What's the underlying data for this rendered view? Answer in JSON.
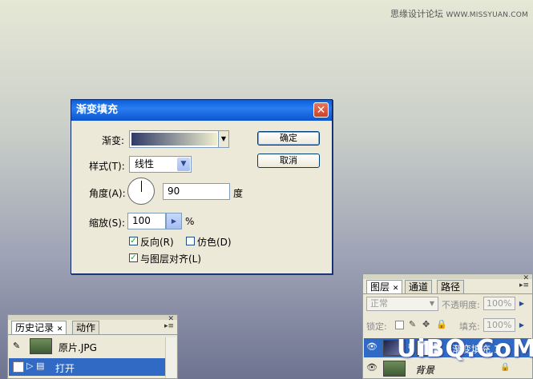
{
  "watermark_top": {
    "cn": "思缘设计论坛",
    "site": "WWW.MISSYUAN.COM"
  },
  "dialog": {
    "title": "渐变填充",
    "gradient_label": "渐变:",
    "style_label": "样式(T):",
    "style_value": "线性",
    "angle_label": "角度(A):",
    "angle_value": "90",
    "angle_unit": "度",
    "scale_label": "缩放(S):",
    "scale_value": "100",
    "scale_unit": "%",
    "reverse_label": "反向(R)",
    "reverse_checked": true,
    "dither_label": "仿色(D)",
    "dither_checked": false,
    "align_label": "与图层对齐(L)",
    "align_checked": true,
    "ok_label": "确定",
    "cancel_label": "取消",
    "gradient_colors": [
      "#2f3a66",
      "#f0efcf"
    ]
  },
  "layers_panel": {
    "tabs": [
      "图层",
      "通道",
      "路径"
    ],
    "blend_mode": "正常",
    "opacity_label": "不透明度:",
    "opacity_value": "100%",
    "lock_label": "锁定:",
    "fill_label": "填充:",
    "fill_value": "100%",
    "layers": [
      {
        "name": "渐变填充 1",
        "selected": true
      },
      {
        "name": "背景",
        "selected": false
      }
    ]
  },
  "history_panel": {
    "tabs": [
      "历史记录",
      "动作"
    ],
    "items": [
      {
        "label": "原片.JPG",
        "selected": false
      },
      {
        "label": "打开",
        "selected": true
      }
    ]
  },
  "watermark_bottom": "UiBQ.CoM",
  "colors": {
    "titlebar": "#0b55d0",
    "selection": "#316ac5",
    "panel_bg": "#ece9d8"
  }
}
